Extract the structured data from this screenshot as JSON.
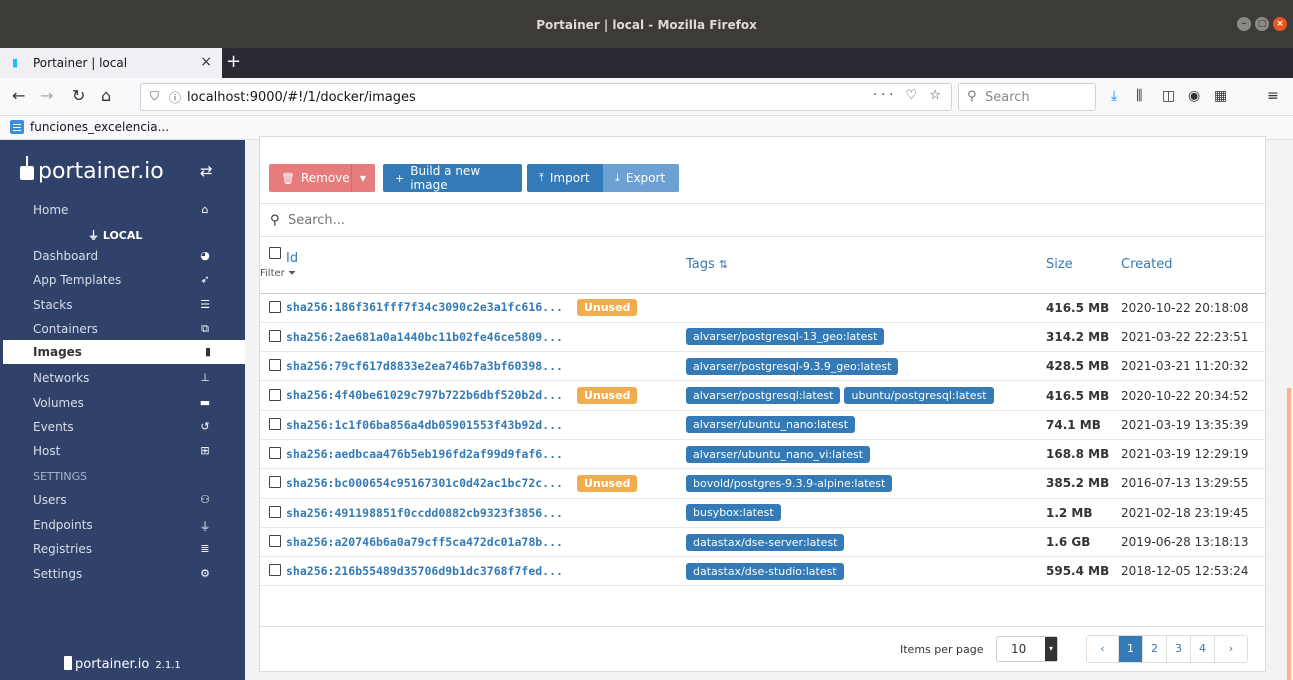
{
  "window": {
    "title": "Portainer | local - Mozilla Firefox"
  },
  "browser": {
    "tab_title": "Portainer | local",
    "url": "localhost:9000/#!/1/docker/images",
    "search_placeholder": "Search",
    "bookmark": "funciones_excelencia..."
  },
  "sidebar": {
    "brand": "portainer.io",
    "home": "Home",
    "endpoint": "LOCAL",
    "items": [
      {
        "label": "Dashboard",
        "icon": "tachometer-icon"
      },
      {
        "label": "App Templates",
        "icon": "rocket-icon"
      },
      {
        "label": "Stacks",
        "icon": "th-list-icon"
      },
      {
        "label": "Containers",
        "icon": "server-icon"
      },
      {
        "label": "Images",
        "icon": "clone-icon"
      },
      {
        "label": "Networks",
        "icon": "sitemap-icon"
      },
      {
        "label": "Volumes",
        "icon": "hdd-icon"
      },
      {
        "label": "Events",
        "icon": "history-icon"
      },
      {
        "label": "Host",
        "icon": "th-icon"
      }
    ],
    "settings_label": "SETTINGS",
    "settings_items": [
      {
        "label": "Users",
        "icon": "users-icon"
      },
      {
        "label": "Endpoints",
        "icon": "plug-icon"
      },
      {
        "label": "Registries",
        "icon": "database-icon"
      },
      {
        "label": "Settings",
        "icon": "cogs-icon"
      }
    ],
    "footer_brand": "portainer.io",
    "version": "2.1.1"
  },
  "toolbar": {
    "remove": "Remove",
    "build": "Build a new image",
    "import": "Import",
    "export": "Export"
  },
  "search": {
    "placeholder": "Search..."
  },
  "table": {
    "headers": {
      "id": "Id",
      "filter": "Filter",
      "tags": "Tags",
      "size": "Size",
      "created": "Created"
    },
    "unused_label": "Unused",
    "rows": [
      {
        "id": "sha256:186f361fff7f34c3090c2e3a1fc616...",
        "unused": true,
        "tags": [],
        "size": "416.5 MB",
        "created": "2020-10-22 20:18:08"
      },
      {
        "id": "sha256:2ae681a0a1440bc11b02fe46ce5809...",
        "unused": false,
        "tags": [
          "alvarser/postgresql-13_geo:latest"
        ],
        "size": "314.2 MB",
        "created": "2021-03-22 22:23:51"
      },
      {
        "id": "sha256:79cf617d8833e2ea746b7a3bf60398...",
        "unused": false,
        "tags": [
          "alvarser/postgresql-9.3.9_geo:latest"
        ],
        "size": "428.5 MB",
        "created": "2021-03-21 11:20:32"
      },
      {
        "id": "sha256:4f40be61029c797b722b6dbf520b2d...",
        "unused": true,
        "tags": [
          "alvarser/postgresql:latest",
          "ubuntu/postgresql:latest"
        ],
        "size": "416.5 MB",
        "created": "2020-10-22 20:34:52"
      },
      {
        "id": "sha256:1c1f06ba856a4db05901553f43b92d...",
        "unused": false,
        "tags": [
          "alvarser/ubuntu_nano:latest"
        ],
        "size": "74.1 MB",
        "created": "2021-03-19 13:35:39"
      },
      {
        "id": "sha256:aedbcaa476b5eb196fd2af99d9faf6...",
        "unused": false,
        "tags": [
          "alvarser/ubuntu_nano_vi:latest"
        ],
        "size": "168.8 MB",
        "created": "2021-03-19 12:29:19"
      },
      {
        "id": "sha256:bc000654c95167301c0d42ac1bc72c...",
        "unused": true,
        "tags": [
          "bovold/postgres-9.3.9-alpine:latest"
        ],
        "size": "385.2 MB",
        "created": "2016-07-13 13:29:55"
      },
      {
        "id": "sha256:491198851f0ccdd0882cb9323f3856...",
        "unused": false,
        "tags": [
          "busybox:latest"
        ],
        "size": "1.2 MB",
        "created": "2021-02-18 23:19:45"
      },
      {
        "id": "sha256:a20746b6a0a79cff5ca472dc01a78b...",
        "unused": false,
        "tags": [
          "datastax/dse-server:latest"
        ],
        "size": "1.6 GB",
        "created": "2019-06-28 13:18:13"
      },
      {
        "id": "sha256:216b55489d35706d9b1dc3768f7fed...",
        "unused": false,
        "tags": [
          "datastax/dse-studio:latest"
        ],
        "size": "595.4 MB",
        "created": "2018-12-05 12:53:24"
      }
    ]
  },
  "pagination": {
    "items_per_page_label": "Items per page",
    "items_per_page": "10",
    "pages": [
      "1",
      "2",
      "3",
      "4"
    ],
    "current": "1"
  }
}
